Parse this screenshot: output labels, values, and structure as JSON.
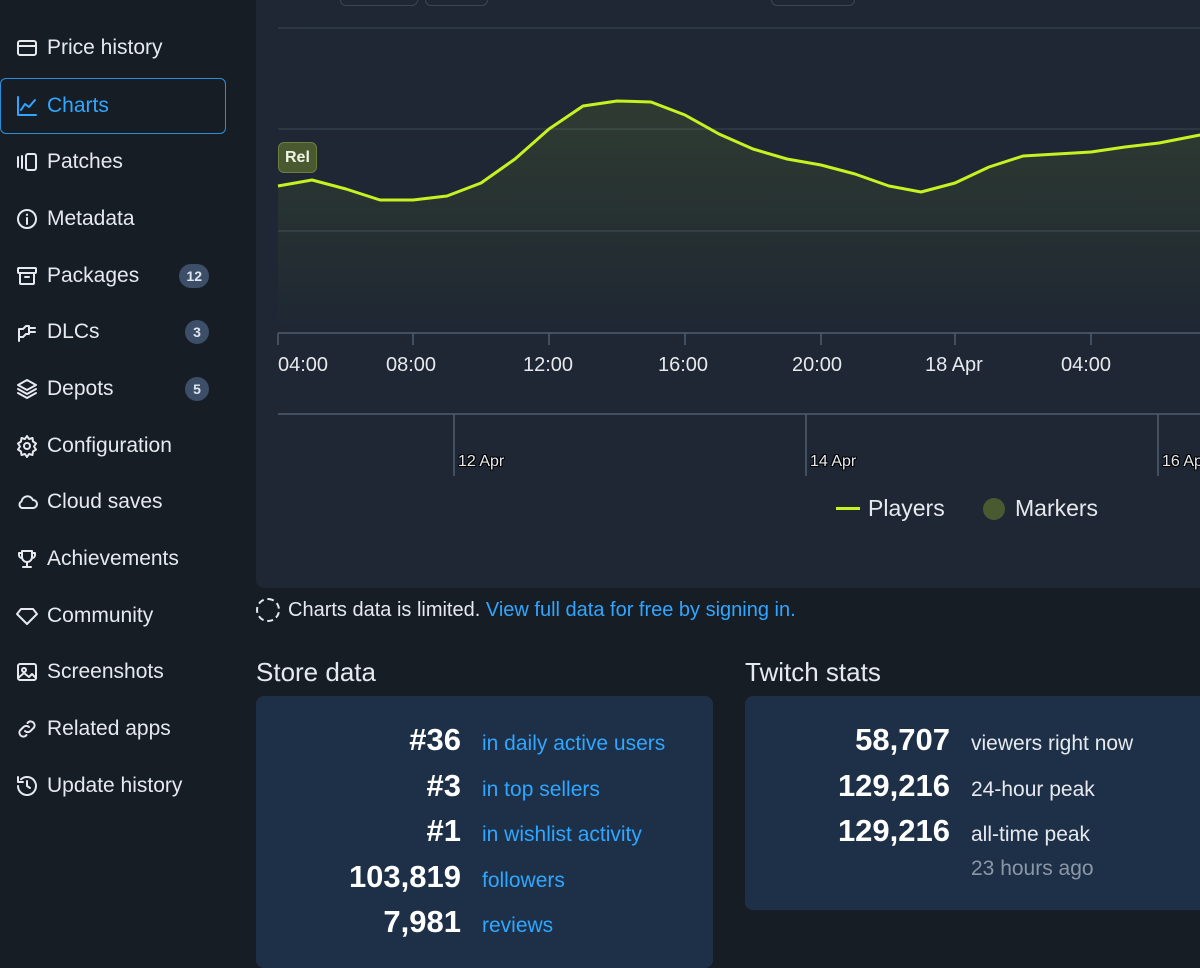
{
  "sidebar": {
    "items": [
      {
        "label": "Price history",
        "icon": "wallet-icon"
      },
      {
        "label": "Charts",
        "icon": "line-chart-icon",
        "active": true
      },
      {
        "label": "Patches",
        "icon": "patches-icon"
      },
      {
        "label": "Metadata",
        "icon": "info-icon"
      },
      {
        "label": "Packages",
        "icon": "archive-icon",
        "badge": "12"
      },
      {
        "label": "DLCs",
        "icon": "plug-icon",
        "badge": "3"
      },
      {
        "label": "Depots",
        "icon": "layers-icon",
        "badge": "5"
      },
      {
        "label": "Configuration",
        "icon": "gear-icon"
      },
      {
        "label": "Cloud saves",
        "icon": "cloud-icon"
      },
      {
        "label": "Achievements",
        "icon": "trophy-icon"
      },
      {
        "label": "Community",
        "icon": "diamond-icon"
      },
      {
        "label": "Screenshots",
        "icon": "image-icon"
      },
      {
        "label": "Related apps",
        "icon": "link-icon"
      },
      {
        "label": "Update history",
        "icon": "history-icon"
      }
    ]
  },
  "chart_data": {
    "type": "line",
    "series": [
      {
        "name": "Players",
        "color": "#c6f221"
      }
    ],
    "x_ticks": [
      "04:00",
      "08:00",
      "12:00",
      "16:00",
      "20:00",
      "18 Apr",
      "04:00"
    ],
    "navigator_ticks": [
      "12 Apr",
      "14 Apr",
      "16 Ap"
    ],
    "markers": [
      {
        "label": "Rel"
      }
    ],
    "legend": [
      "Players",
      "Markers"
    ],
    "legend_placement": "bottom-right",
    "grid": true
  },
  "notice": {
    "text": "Charts data is limited.",
    "link": "View full data for free by signing in."
  },
  "store": {
    "title": "Store data",
    "rows": [
      {
        "value": "#36",
        "label": "in daily active users"
      },
      {
        "value": "#3",
        "label": "in top sellers"
      },
      {
        "value": "#1",
        "label": "in wishlist activity"
      },
      {
        "value": "103,819",
        "label": "followers"
      },
      {
        "value": "7,981",
        "label": "reviews"
      }
    ]
  },
  "twitch": {
    "title": "Twitch stats",
    "rows": [
      {
        "value": "58,707",
        "label": "viewers right now"
      },
      {
        "value": "129,216",
        "label": "24-hour peak"
      },
      {
        "value": "129,216",
        "label": "all-time peak"
      }
    ],
    "alltime_when": "23 hours ago"
  },
  "colors": {
    "accent": "#2fa6ff",
    "series": "#c6f221",
    "marker": "#4a5a30"
  }
}
